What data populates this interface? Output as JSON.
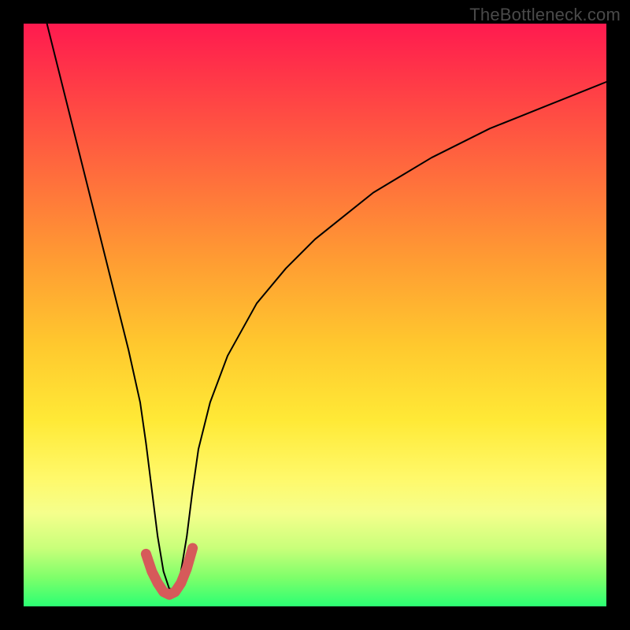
{
  "attribution": "TheBottleneck.com",
  "chart_data": {
    "type": "line",
    "title": "",
    "xlabel": "",
    "ylabel": "",
    "xlim": [
      0,
      100
    ],
    "ylim": [
      0,
      100
    ],
    "grid": false,
    "legend": false,
    "annotations": [],
    "series": [
      {
        "name": "bottleneck-curve",
        "color": "#000000",
        "x": [
          4,
          6,
          8,
          10,
          12,
          14,
          16,
          18,
          20,
          21,
          22,
          23,
          24,
          25,
          26,
          27,
          28,
          29,
          30,
          32,
          35,
          40,
          45,
          50,
          55,
          60,
          65,
          70,
          75,
          80,
          85,
          90,
          95,
          100
        ],
        "values": [
          100,
          92,
          84,
          76,
          68,
          60,
          52,
          44,
          35,
          28,
          20,
          12,
          6,
          3,
          3,
          6,
          12,
          20,
          27,
          35,
          43,
          52,
          58,
          63,
          67,
          71,
          74,
          77,
          79.5,
          82,
          84,
          86,
          88,
          90
        ]
      },
      {
        "name": "optimal-zone-highlight",
        "color": "#d65a5a",
        "x": [
          21,
          22,
          23,
          24,
          25,
          26,
          27,
          28,
          29
        ],
        "values": [
          9,
          6,
          4,
          2.5,
          2,
          2.5,
          4,
          6.5,
          10
        ]
      }
    ],
    "background_gradient": {
      "direction": "vertical",
      "stops": [
        {
          "pos": 0,
          "color": "#ff1a4f"
        },
        {
          "pos": 25,
          "color": "#ff6a3d"
        },
        {
          "pos": 55,
          "color": "#ffc82e"
        },
        {
          "pos": 78,
          "color": "#fff96a"
        },
        {
          "pos": 100,
          "color": "#2bff73"
        }
      ]
    }
  }
}
